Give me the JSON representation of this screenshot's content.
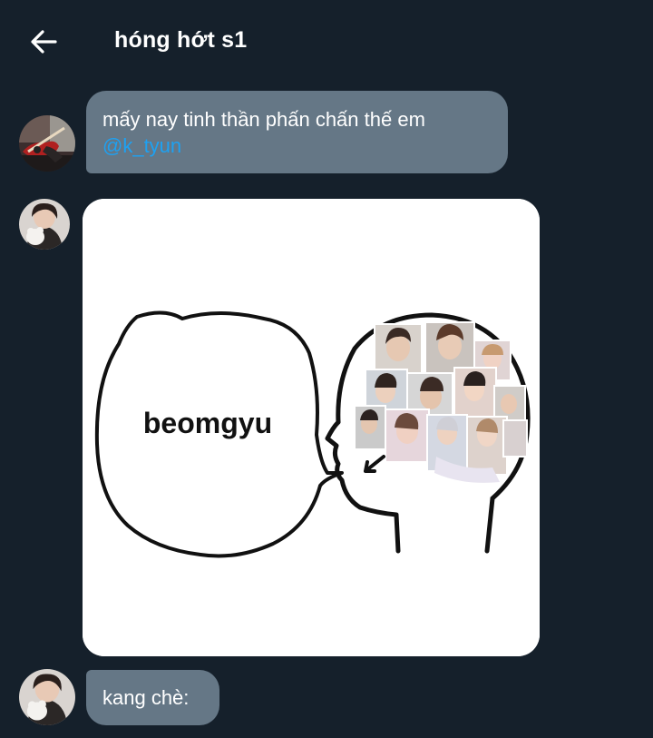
{
  "header": {
    "title": "hóng hớt s1",
    "back_icon": "arrow-left-icon"
  },
  "messages": [
    {
      "type": "text",
      "text": "mấy nay tinh thần phấn chấn thế em",
      "mention": "@k_tyun",
      "avatar": "guitar-avatar"
    },
    {
      "type": "image",
      "meme_text": "beomgyu",
      "avatar": "person-avatar"
    },
    {
      "type": "text",
      "text": "kang chè:",
      "avatar": "person-avatar"
    }
  ],
  "colors": {
    "background": "#15202b",
    "bubble": "#657786",
    "mention": "#1da1f2",
    "text": "#ffffff"
  }
}
